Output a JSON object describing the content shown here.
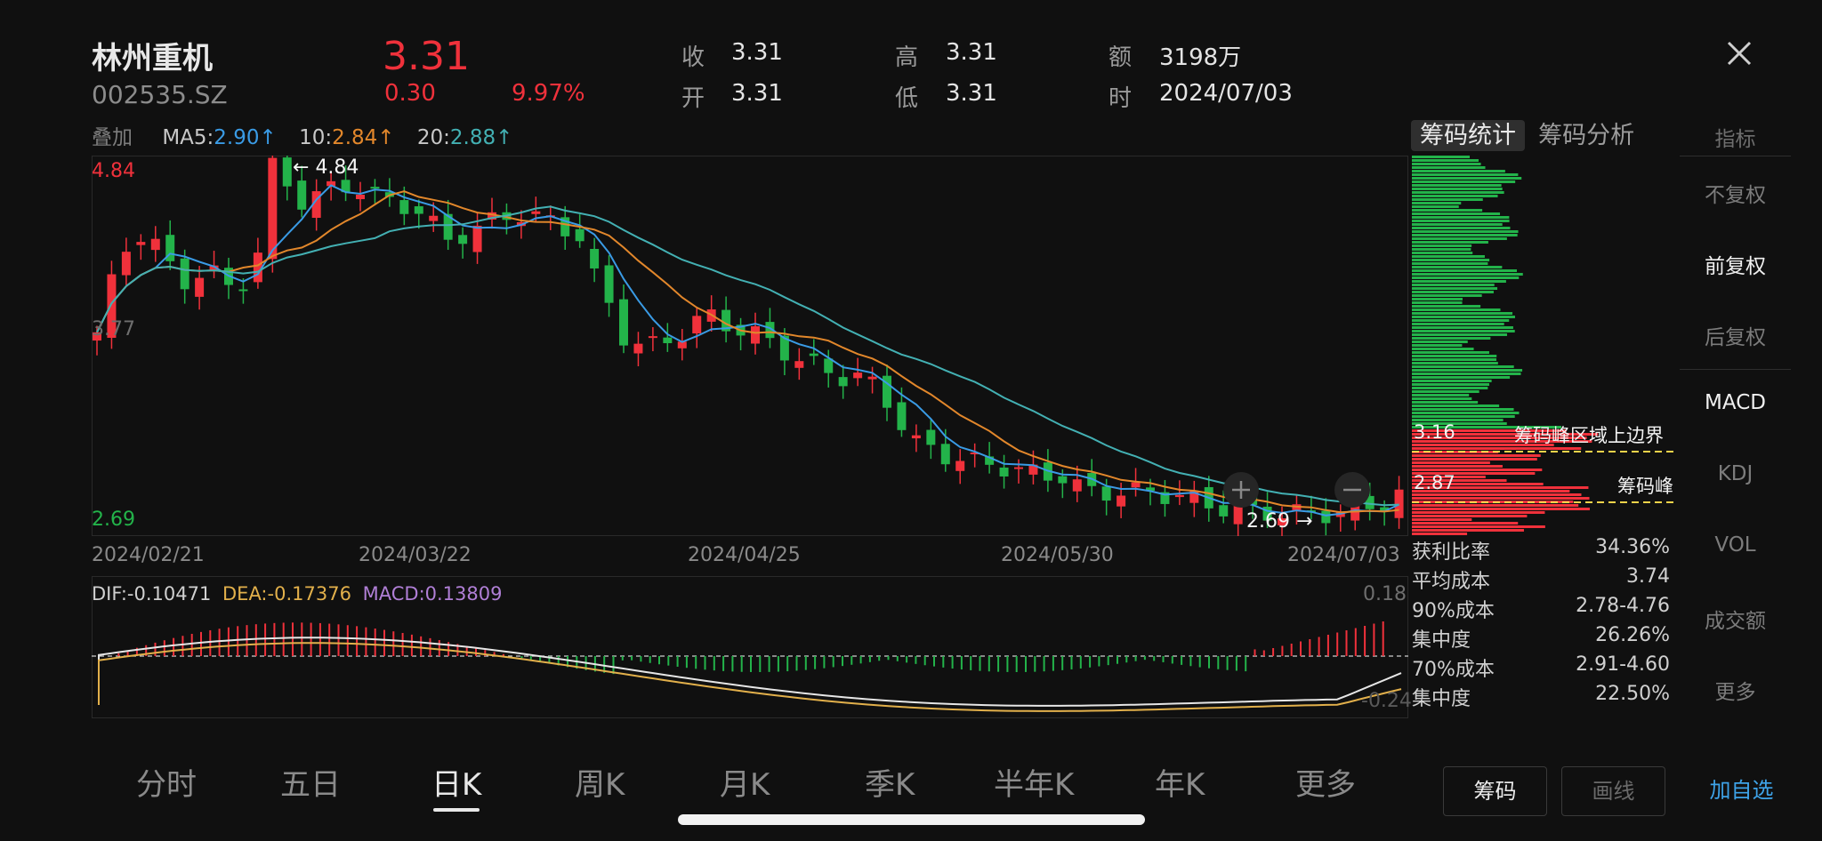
{
  "stock": {
    "name": "林州重机",
    "code": "002535.SZ",
    "price": "3.31",
    "change": "0.30",
    "change_pct": "9.97%"
  },
  "quote": [
    {
      "label": "收",
      "value": "3.31"
    },
    {
      "label": "开",
      "value": "3.31"
    },
    {
      "label": "高",
      "value": "3.31"
    },
    {
      "label": "低",
      "value": "3.31"
    },
    {
      "label": "额",
      "value": "3198万"
    },
    {
      "label": "时",
      "value": "2024/07/03"
    }
  ],
  "ma_legend": {
    "overlay": "叠加",
    "ma5_label": "MA5:",
    "ma5_value": "2.90↑",
    "ma10_label": "10:",
    "ma10_value": "2.84↑",
    "ma20_label": "20:",
    "ma20_value": "2.88↑"
  },
  "kchart": {
    "y_high_label": "4.84",
    "y_low_label": "2.69",
    "y_mid_label": "3.77",
    "max_marker": "4.84",
    "min_marker": "2.69",
    "dates": [
      "2024/02/21",
      "2024/03/22",
      "2024/04/25",
      "2024/05/30",
      "2024/07/03"
    ],
    "colors": {
      "up": "#f0313b",
      "down": "#23b34a",
      "ma5": "#3a9be5",
      "ma10": "#e2872b",
      "ma20": "#43b0b3"
    }
  },
  "macd": {
    "dif_text": "DIF:-0.10471",
    "dea_text": "DEA:-0.17376",
    "macd_text": "MACD:0.13809",
    "top_label": "0.18",
    "bottom_label": "-0.24"
  },
  "chip": {
    "tabs": [
      "筹码统计",
      "筹码分析"
    ],
    "upper_label": "3.16",
    "upper_text": "筹码峰区域上边界",
    "peak_label": "2.87",
    "peak_text": "筹码峰",
    "stats": [
      {
        "label": "获利比率",
        "value": "34.36%"
      },
      {
        "label": "平均成本",
        "value": "3.74"
      },
      {
        "label": "90%成本",
        "value": "2.78-4.76"
      },
      {
        "label": "集中度",
        "value": "26.26%"
      },
      {
        "label": "70%成本",
        "value": "2.91-4.60"
      },
      {
        "label": "集中度",
        "value": "22.50%"
      }
    ]
  },
  "side_menu": {
    "header": "指标",
    "items": [
      "不复权",
      "前复权",
      "后复权",
      "MACD",
      "KDJ",
      "VOL",
      "成交额",
      "更多"
    ]
  },
  "period_tabs": [
    "分时",
    "五日",
    "日K",
    "周K",
    "月K",
    "季K",
    "半年K",
    "年K",
    "更多"
  ],
  "buttons": {
    "chip": "筹码",
    "draw": "画线",
    "add_watch": "加自选"
  }
}
